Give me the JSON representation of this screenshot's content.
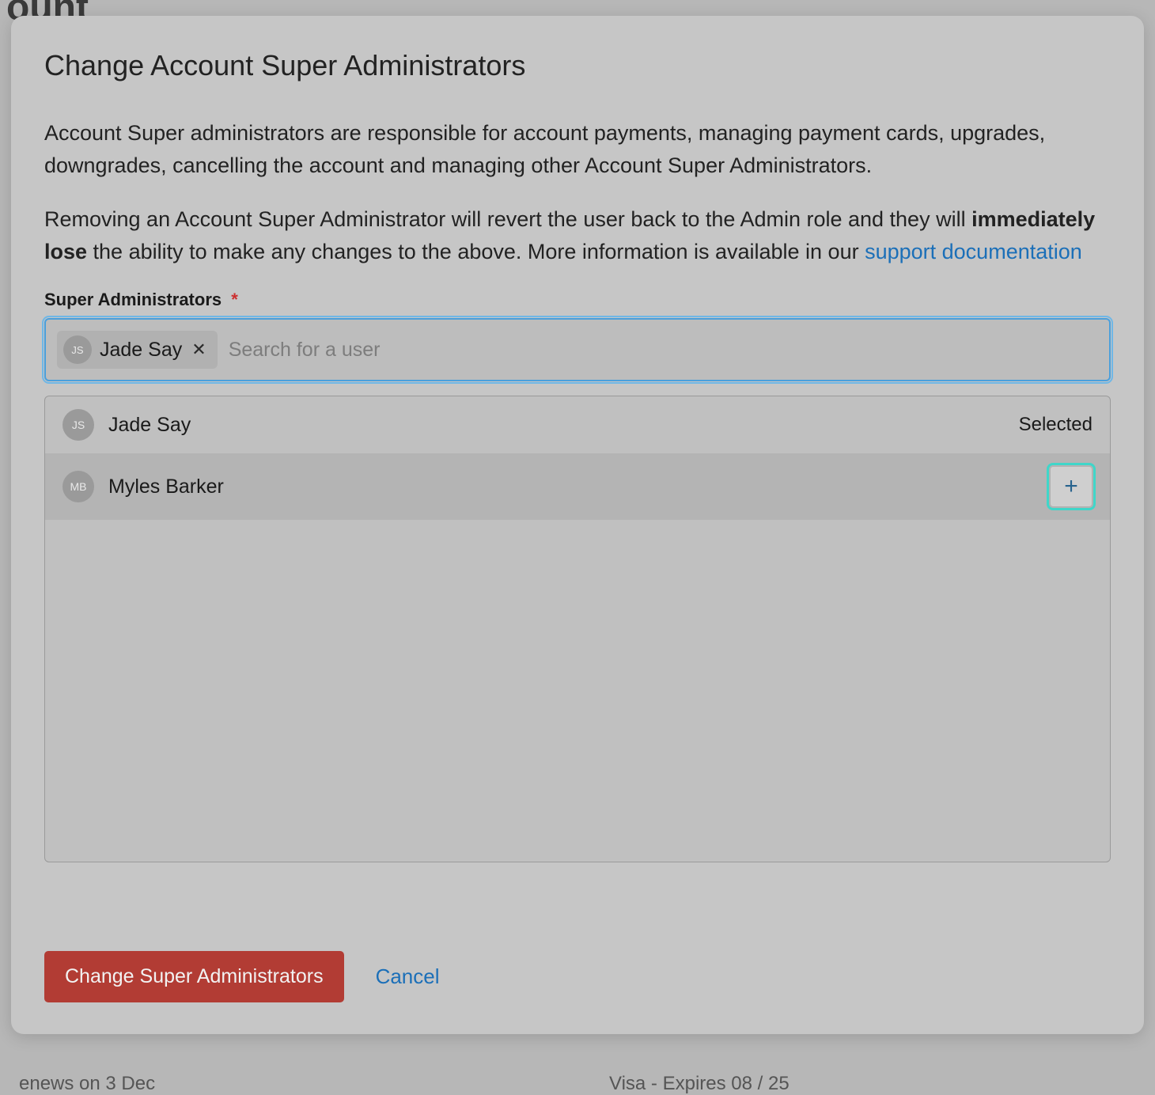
{
  "modal": {
    "title": "Change Account Super Administrators",
    "desc1": "Account Super administrators are responsible for account payments, managing payment cards, upgrades, downgrades, cancelling the account and managing other Account Super Administrators.",
    "desc2_a": "Removing an Account Super Administrator will revert the user back to the Admin role and they will ",
    "desc2_strong": "immediately lose",
    "desc2_b": " the ability to make any changes to the above. More information is available in our ",
    "desc2_link": "support documentation",
    "field_label": "Super Administrators",
    "required_marker": "*",
    "search_placeholder": "Search for a user",
    "chips": [
      {
        "initials": "JS",
        "name": "Jade Say"
      }
    ],
    "options": [
      {
        "initials": "JS",
        "name": "Jade Say",
        "selected": true,
        "status": "Selected"
      },
      {
        "initials": "MB",
        "name": "Myles Barker",
        "selected": false
      }
    ],
    "submit_label": "Change Super Administrators",
    "cancel_label": "Cancel"
  },
  "background": {
    "frag_top": "ount",
    "frag_bottom_left": "enews on 3 Dec",
    "frag_bottom_right": "Visa - Expires 08 / 25"
  }
}
